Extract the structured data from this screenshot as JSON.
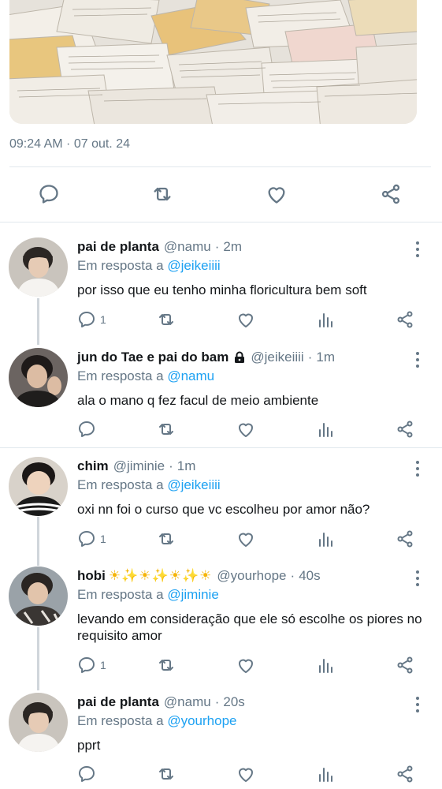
{
  "tweet": {
    "timestamp": "09:24 AM · 07 out. 24"
  },
  "main_actions": [
    "reply-icon",
    "retweet-icon",
    "like-icon",
    "share-icon"
  ],
  "replies": [
    {
      "name": "pai de planta",
      "emoji": "",
      "handle": "@namu",
      "time": "2m",
      "replying_prefix": "Em resposta a",
      "replying_to": "@jeikeiiii",
      "text": "por isso que eu tenho minha floricultura bem soft",
      "reply_count": "1"
    },
    {
      "name": "jun do Tae e pai do bam",
      "emoji": "",
      "handle": "@jeikeiiii",
      "time": "1m",
      "replying_prefix": "Em resposta a",
      "replying_to": "@namu",
      "text": "ala o mano q fez facul de meio ambiente",
      "reply_count": ""
    },
    {
      "name": "chim",
      "emoji": "",
      "handle": "@jiminie",
      "time": "1m",
      "replying_prefix": "Em resposta a",
      "replying_to": "@jeikeiiii",
      "text": "oxi nn foi o curso que vc escolheu por amor não?",
      "reply_count": "1"
    },
    {
      "name": "hobi",
      "emoji": "☀✨☀✨☀✨☀",
      "handle": "@yourhope",
      "time": "40s",
      "replying_prefix": "Em resposta a",
      "replying_to": "@jiminie",
      "text": "levando em consideração que ele só escolhe os piores no requisito amor",
      "reply_count": "1"
    },
    {
      "name": "pai de planta",
      "emoji": "",
      "handle": "@namu",
      "time": "20s",
      "replying_prefix": "Em resposta a",
      "replying_to": "@yourhope",
      "text": "pprt",
      "reply_count": ""
    }
  ],
  "colors": {
    "text": "#14171a",
    "muted": "#657786",
    "mention": "#1da1f2",
    "divider": "#e1e8ed"
  }
}
